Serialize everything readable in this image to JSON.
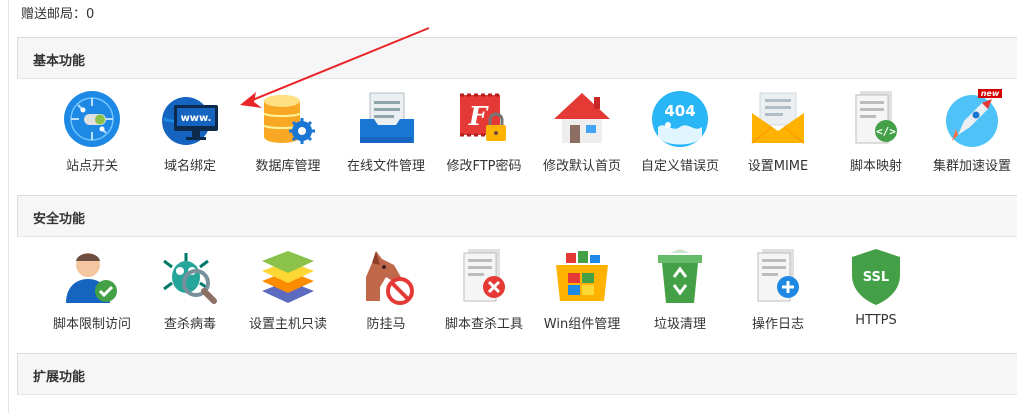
{
  "gift_mail": "赠送邮局：0",
  "sections": [
    {
      "title": "基本功能",
      "items": [
        {
          "label": "站点开关",
          "icon": "site-switch-icon"
        },
        {
          "label": "域名绑定",
          "icon": "domain-bind-icon"
        },
        {
          "label": "数据库管理",
          "icon": "database-icon"
        },
        {
          "label": "在线文件管理",
          "icon": "file-manager-icon"
        },
        {
          "label": "修改FTP密码",
          "icon": "ftp-password-icon"
        },
        {
          "label": "修改默认首页",
          "icon": "home-page-icon"
        },
        {
          "label": "自定义错误页",
          "icon": "error-page-icon"
        },
        {
          "label": "设置MIME",
          "icon": "mime-icon"
        },
        {
          "label": "脚本映射",
          "icon": "script-map-icon"
        },
        {
          "label": "集群加速设置",
          "icon": "cluster-boost-icon",
          "badge": "new"
        }
      ]
    },
    {
      "title": "安全功能",
      "items": [
        {
          "label": "脚本限制访问",
          "icon": "user-check-icon"
        },
        {
          "label": "查杀病毒",
          "icon": "virus-scan-icon"
        },
        {
          "label": "设置主机只读",
          "icon": "layers-icon"
        },
        {
          "label": "防挂马",
          "icon": "horse-block-icon"
        },
        {
          "label": "脚本查杀工具",
          "icon": "doc-delete-icon"
        },
        {
          "label": "Win组件管理",
          "icon": "win-box-icon"
        },
        {
          "label": "垃圾清理",
          "icon": "recycle-bin-icon"
        },
        {
          "label": "操作日志",
          "icon": "doc-add-icon"
        },
        {
          "label": "HTTPS",
          "icon": "ssl-shield-icon",
          "shield_text": "SSL"
        }
      ]
    },
    {
      "title": "扩展功能",
      "items": []
    }
  ],
  "colors": {
    "annotation_arrow": "#e8262a",
    "header_bg": "#f6f6f6"
  }
}
